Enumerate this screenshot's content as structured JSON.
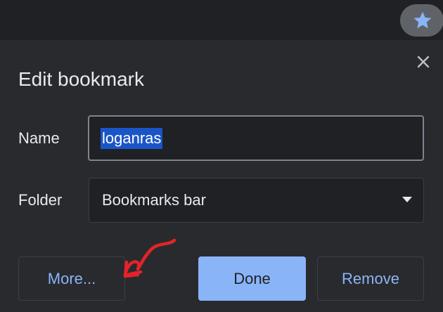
{
  "toolbar": {
    "bookmark_star_icon": "star-icon"
  },
  "dialog": {
    "title": "Edit bookmark",
    "close_icon": "close-icon",
    "name_label": "Name",
    "name_value": "loganras",
    "folder_label": "Folder",
    "folder_value": "Bookmarks bar",
    "more_label": "More...",
    "done_label": "Done",
    "remove_label": "Remove"
  },
  "colors": {
    "accent": "#8ab4f8",
    "background": "#292a2d",
    "annotation": "#e3232a"
  }
}
